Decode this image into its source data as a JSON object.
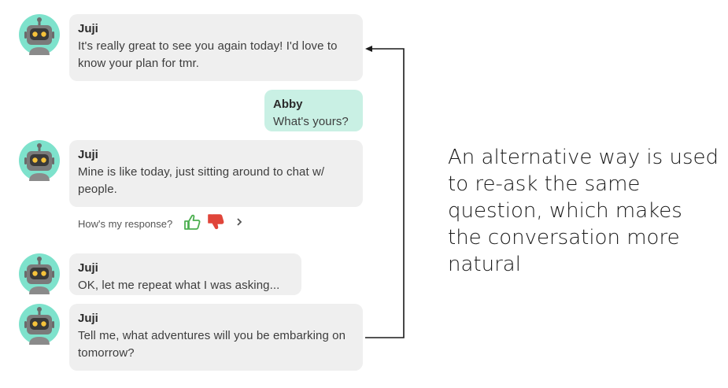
{
  "messages": [
    {
      "sender": "Juji",
      "text": "It's really great to see you again today! I'd love to know your plan for tmr."
    },
    {
      "sender": "Abby",
      "text": "What's yours?"
    },
    {
      "sender": "Juji",
      "text": "Mine is like today, just sitting around to chat w/ people."
    },
    {
      "sender": "Juji",
      "text": "OK, let me repeat what I was asking..."
    },
    {
      "sender": "Juji",
      "text": "Tell me, what adventures will you be embarking on tomorrow?"
    }
  ],
  "feedback": {
    "label": "How's my response?",
    "thumbs_up_icon": "thumbs-up-icon",
    "thumbs_down_icon": "thumbs-down-icon",
    "more_icon": "chevron-right-icon",
    "up_color": "#4caf50",
    "down_color": "#e0453a"
  },
  "annotation": {
    "text": "An alternative way is used to re-ask the same question, which makes the conversation more natural"
  },
  "colors": {
    "bot_bubble": "#efefef",
    "user_bubble": "#c9f0e4",
    "avatar_bg": "#7ee2cc"
  }
}
